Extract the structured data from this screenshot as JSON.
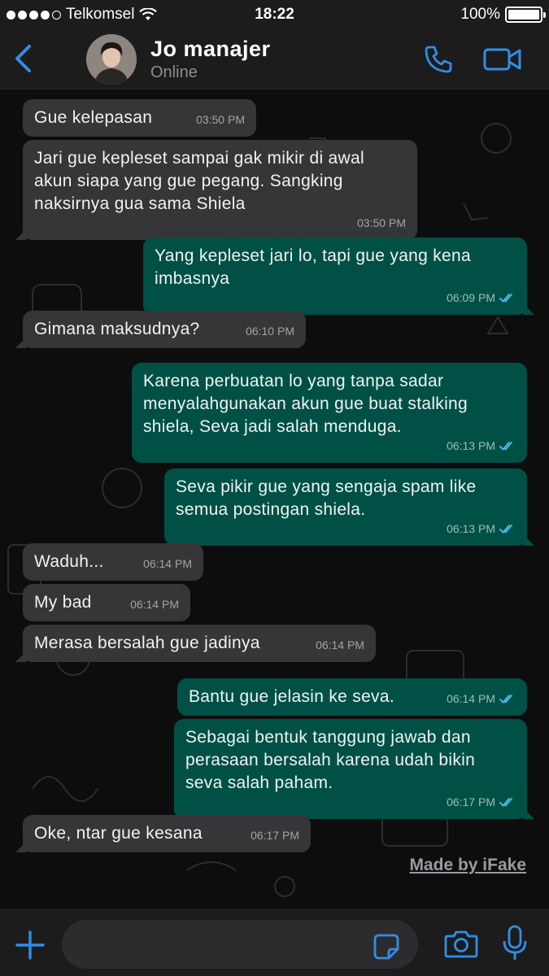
{
  "status_bar": {
    "carrier": "Telkomsel",
    "time": "18:22",
    "battery": "100%",
    "battery_level": 1.0
  },
  "header": {
    "contact_name": "Jo manajer",
    "contact_status": "Online",
    "icons": [
      "back-chevron-icon",
      "avatar",
      "phone-icon",
      "video-camera-icon"
    ]
  },
  "colors": {
    "accent": "#2f8fe6",
    "incoming_bubble": "#363638",
    "outgoing_bubble": "#005046",
    "read_ticks": "#53bdeb"
  },
  "messages": [
    {
      "direction": "in",
      "text": "Gue kelepasan",
      "time": "03:50 PM"
    },
    {
      "direction": "in",
      "text": "Jari gue kepleset sampai gak mikir di awal akun siapa yang gue pegang. Sangking naksirnya gua sama Shiela",
      "time": "03:50 PM"
    },
    {
      "direction": "out",
      "text": "Yang kepleset jari lo, tapi gue yang kena imbasnya",
      "time": "06:09 PM",
      "status": "read"
    },
    {
      "direction": "in",
      "text": "Gimana maksudnya?",
      "time": "06:10 PM"
    },
    {
      "direction": "out",
      "text": "Karena perbuatan lo yang tanpa sadar menyalahgunakan akun gue buat stalking shiela, Seva jadi salah menduga.",
      "time": "06:13 PM",
      "status": "read"
    },
    {
      "direction": "out",
      "text": "Seva pikir gue yang sengaja spam like semua postingan shiela.",
      "time": "06:13 PM",
      "status": "read"
    },
    {
      "direction": "in",
      "text": "Waduh...",
      "time": "06:14 PM"
    },
    {
      "direction": "in",
      "text": "My bad",
      "time": "06:14 PM"
    },
    {
      "direction": "in",
      "text": "Merasa bersalah gue jadinya",
      "time": "06:14 PM"
    },
    {
      "direction": "out",
      "text": "Bantu gue jelasin ke seva.",
      "time": "06:14 PM",
      "status": "read"
    },
    {
      "direction": "out",
      "text": "Sebagai bentuk tanggung jawab dan perasaan bersalah karena udah bikin seva salah paham.",
      "time": "06:17 PM",
      "status": "read"
    },
    {
      "direction": "in",
      "text": "Oke, ntar gue kesana",
      "time": "06:17 PM"
    }
  ],
  "watermark": "Made by iFake",
  "input_bar": {
    "placeholder": "",
    "icons": [
      "plus-icon",
      "sticker-icon",
      "camera-icon",
      "microphone-icon"
    ]
  }
}
